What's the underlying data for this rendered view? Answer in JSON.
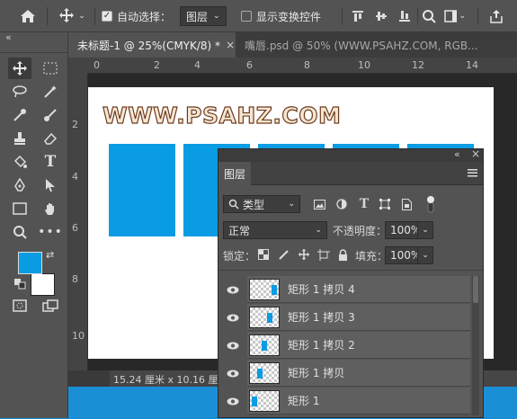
{
  "options_bar": {
    "auto_select_label": "自动选择：",
    "auto_select_value": "图层",
    "show_transform_label": "显示变换控件",
    "icons": [
      "home-icon",
      "move-tool-icon",
      "align-top-icon",
      "align-vcenter-icon",
      "align-bottom-icon",
      "search-icon",
      "workspace-icon",
      "share-icon"
    ]
  },
  "tabs": [
    {
      "label": "未标题-1 @ 25%(CMYK/8) *",
      "close": "×",
      "active": true
    },
    {
      "label": "嘴唇.psd @ 50% (WWW.PSAHZ.COM, RGB...",
      "active": false
    }
  ],
  "collapse_glyph": "«",
  "ruler_top": [
    "0",
    "2",
    "4",
    "6",
    "8",
    "10",
    "12",
    "14"
  ],
  "ruler_left": [
    "2",
    "4",
    "6",
    "8",
    "10"
  ],
  "canvas": {
    "text": "WWW.PSAHZ.COM",
    "rect_color": "#0a9ce3"
  },
  "status_bar": {
    "doc_size": "15.24 厘米 x 10.16 厘米"
  },
  "colors": {
    "foreground": "#0a9ce3",
    "background": "#ffffff"
  },
  "layers_panel": {
    "title": "图层",
    "filter_label": "类型",
    "blend_mode": "正常",
    "opacity_label": "不透明度：",
    "opacity_value": "100%",
    "lock_label": "锁定：",
    "fill_label": "填充：",
    "fill_value": "100%",
    "layers": [
      {
        "name": "矩形 1 拷贝 4"
      },
      {
        "name": "矩形 1 拷贝 3"
      },
      {
        "name": "矩形 1 拷贝 2"
      },
      {
        "name": "矩形 1 拷贝"
      },
      {
        "name": "矩形 1"
      }
    ]
  }
}
